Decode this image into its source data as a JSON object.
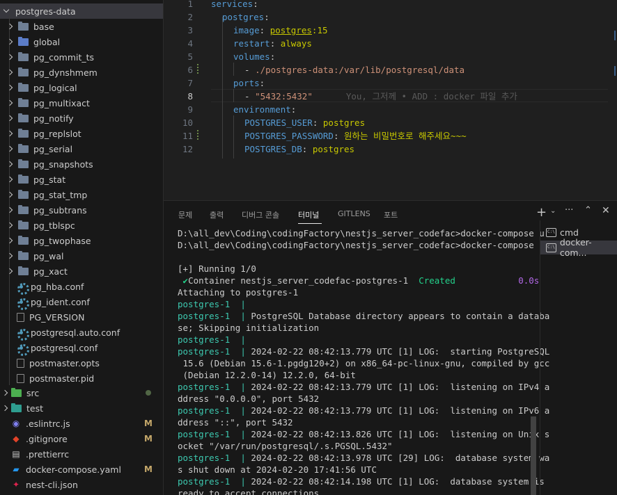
{
  "explorer": {
    "root": "postgres-data",
    "items": [
      {
        "label": "base",
        "kind": "folder"
      },
      {
        "label": "global",
        "kind": "folder-blue"
      },
      {
        "label": "pg_commit_ts",
        "kind": "folder"
      },
      {
        "label": "pg_dynshmem",
        "kind": "folder"
      },
      {
        "label": "pg_logical",
        "kind": "folder"
      },
      {
        "label": "pg_multixact",
        "kind": "folder"
      },
      {
        "label": "pg_notify",
        "kind": "folder"
      },
      {
        "label": "pg_replslot",
        "kind": "folder"
      },
      {
        "label": "pg_serial",
        "kind": "folder"
      },
      {
        "label": "pg_snapshots",
        "kind": "folder"
      },
      {
        "label": "pg_stat",
        "kind": "folder"
      },
      {
        "label": "pg_stat_tmp",
        "kind": "folder"
      },
      {
        "label": "pg_subtrans",
        "kind": "folder"
      },
      {
        "label": "pg_tblspc",
        "kind": "folder"
      },
      {
        "label": "pg_twophase",
        "kind": "folder"
      },
      {
        "label": "pg_wal",
        "kind": "folder"
      },
      {
        "label": "pg_xact",
        "kind": "folder"
      },
      {
        "label": "pg_hba.conf",
        "kind": "gear"
      },
      {
        "label": "pg_ident.conf",
        "kind": "gear"
      },
      {
        "label": "PG_VERSION",
        "kind": "file"
      },
      {
        "label": "postgresql.auto.conf",
        "kind": "gear"
      },
      {
        "label": "postgresql.conf",
        "kind": "gear"
      },
      {
        "label": "postmaster.opts",
        "kind": "file"
      },
      {
        "label": "postmaster.pid",
        "kind": "file"
      }
    ],
    "top_items": [
      {
        "label": "src",
        "badge": ""
      },
      {
        "label": "test",
        "badge": ""
      },
      {
        "label": ".eslintrc.js",
        "badge": "M"
      },
      {
        "label": ".gitignore",
        "badge": "M"
      },
      {
        "label": ".prettierrc",
        "badge": ""
      },
      {
        "label": "docker-compose.yaml",
        "badge": "M"
      },
      {
        "label": "nest-cli.json",
        "badge": ""
      }
    ]
  },
  "editor": {
    "lines": [
      {
        "n": "1",
        "t1": "services",
        "t2": ":"
      },
      {
        "n": "2",
        "t1": "postgres",
        "t2": ":"
      },
      {
        "n": "3",
        "t1": "image",
        "t2": ": ",
        "t3": "postgres",
        "t4": ":15"
      },
      {
        "n": "4",
        "t1": "restart",
        "t2": ": ",
        "t3": "always"
      },
      {
        "n": "5",
        "t1": "volumes",
        "t2": ":"
      },
      {
        "n": "6",
        "t1": "- ",
        "t2": "./postgres-data:/var/lib/postgresql/data"
      },
      {
        "n": "7",
        "t1": "ports",
        "t2": ":"
      },
      {
        "n": "8",
        "t1": "- ",
        "t2": "\"5432:5432\""
      },
      {
        "n": "9",
        "t1": "environment",
        "t2": ":"
      },
      {
        "n": "10",
        "t1": "POSTGRES_USER",
        "t2": ": ",
        "t3": "postgres"
      },
      {
        "n": "11",
        "t1": "POSTGRES_PASSWORD",
        "t2": ": ",
        "t3": "원하는 비밀번호로 해주세요~~~"
      },
      {
        "n": "12",
        "t1": "POSTGRES_DB",
        "t2": ": ",
        "t3": "postgres"
      }
    ],
    "blame": "You, 그저께 • ADD : docker 파일 추가"
  },
  "panel": {
    "tabs": [
      "문제",
      "출력",
      "디버그 콘솔",
      "터미널",
      "GITLENS",
      "포트"
    ],
    "active_tab": "터미널",
    "terminals": [
      "cmd",
      "docker-com..."
    ],
    "terminal_lines": [
      {
        "parts": [
          {
            "t": "D:\\all_dev\\Coding\\codingFactory\\nestjs_server_codefac>docker-compose u",
            "c": ""
          }
        ]
      },
      {
        "parts": [
          {
            "t": "D:\\all_dev\\Coding\\codingFactory\\nestjs_server_codefac>docker-compose up",
            "c": ""
          }
        ]
      },
      {
        "parts": [
          {
            "t": "",
            "c": ""
          }
        ]
      },
      {
        "parts": [
          {
            "t": "[+] Running 1/0",
            "c": ""
          }
        ]
      },
      {
        "parts": [
          {
            "t": " ✔",
            "c": "tg"
          },
          {
            "t": "Container nestjs_server_codefac-postgres-1  ",
            "c": ""
          },
          {
            "t": "Created",
            "c": "tg"
          },
          {
            "t": "            ",
            "c": ""
          },
          {
            "t": "0.0s",
            "c": "tm"
          }
        ]
      },
      {
        "parts": [
          {
            "t": "Attaching to postgres-1",
            "c": ""
          }
        ]
      },
      {
        "parts": [
          {
            "t": "postgres-1  ",
            "c": "tc"
          },
          {
            "t": "|",
            "c": "tsep"
          }
        ]
      },
      {
        "parts": [
          {
            "t": "postgres-1  ",
            "c": "tc"
          },
          {
            "t": "|",
            "c": "tsep"
          },
          {
            "t": " PostgreSQL Database directory appears to contain a databa",
            "c": ""
          }
        ]
      },
      {
        "parts": [
          {
            "t": "se; Skipping initialization",
            "c": ""
          }
        ]
      },
      {
        "parts": [
          {
            "t": "postgres-1  ",
            "c": "tc"
          },
          {
            "t": "|",
            "c": "tsep"
          }
        ]
      },
      {
        "parts": [
          {
            "t": "postgres-1  ",
            "c": "tc"
          },
          {
            "t": "|",
            "c": "tsep"
          },
          {
            "t": " 2024-02-22 08:42:13.779 UTC [1] LOG:  starting PostgreSQL",
            "c": ""
          }
        ]
      },
      {
        "parts": [
          {
            "t": " 15.6 (Debian 15.6-1.pgdg120+2) on x86_64-pc-linux-gnu, compiled by gcc",
            "c": ""
          }
        ]
      },
      {
        "parts": [
          {
            "t": " (Debian 12.2.0-14) 12.2.0, 64-bit",
            "c": ""
          }
        ]
      },
      {
        "parts": [
          {
            "t": "postgres-1  ",
            "c": "tc"
          },
          {
            "t": "|",
            "c": "tsep"
          },
          {
            "t": " 2024-02-22 08:42:13.779 UTC [1] LOG:  listening on IPv4 a",
            "c": ""
          }
        ]
      },
      {
        "parts": [
          {
            "t": "ddress \"0.0.0.0\", port 5432",
            "c": ""
          }
        ]
      },
      {
        "parts": [
          {
            "t": "postgres-1  ",
            "c": "tc"
          },
          {
            "t": "|",
            "c": "tsep"
          },
          {
            "t": " 2024-02-22 08:42:13.779 UTC [1] LOG:  listening on IPv6 a",
            "c": ""
          }
        ]
      },
      {
        "parts": [
          {
            "t": "ddress \"::\", port 5432",
            "c": ""
          }
        ]
      },
      {
        "parts": [
          {
            "t": "postgres-1  ",
            "c": "tc"
          },
          {
            "t": "|",
            "c": "tsep"
          },
          {
            "t": " 2024-02-22 08:42:13.826 UTC [1] LOG:  listening on Unix s",
            "c": ""
          }
        ]
      },
      {
        "parts": [
          {
            "t": "ocket \"/var/run/postgresql/.s.PGSQL.5432\"",
            "c": ""
          }
        ]
      },
      {
        "parts": [
          {
            "t": "postgres-1  ",
            "c": "tc"
          },
          {
            "t": "|",
            "c": "tsep"
          },
          {
            "t": " 2024-02-22 08:42:13.978 UTC [29] LOG:  database system wa",
            "c": ""
          }
        ]
      },
      {
        "parts": [
          {
            "t": "s shut down at 2024-02-20 17:41:56 UTC",
            "c": ""
          }
        ]
      },
      {
        "parts": [
          {
            "t": "postgres-1  ",
            "c": "tc"
          },
          {
            "t": "|",
            "c": "tsep"
          },
          {
            "t": " 2024-02-22 08:42:14.198 UTC [1] LOG:  database system is",
            "c": ""
          }
        ]
      },
      {
        "parts": [
          {
            "t": "ready to accept connections",
            "c": ""
          }
        ]
      }
    ]
  }
}
